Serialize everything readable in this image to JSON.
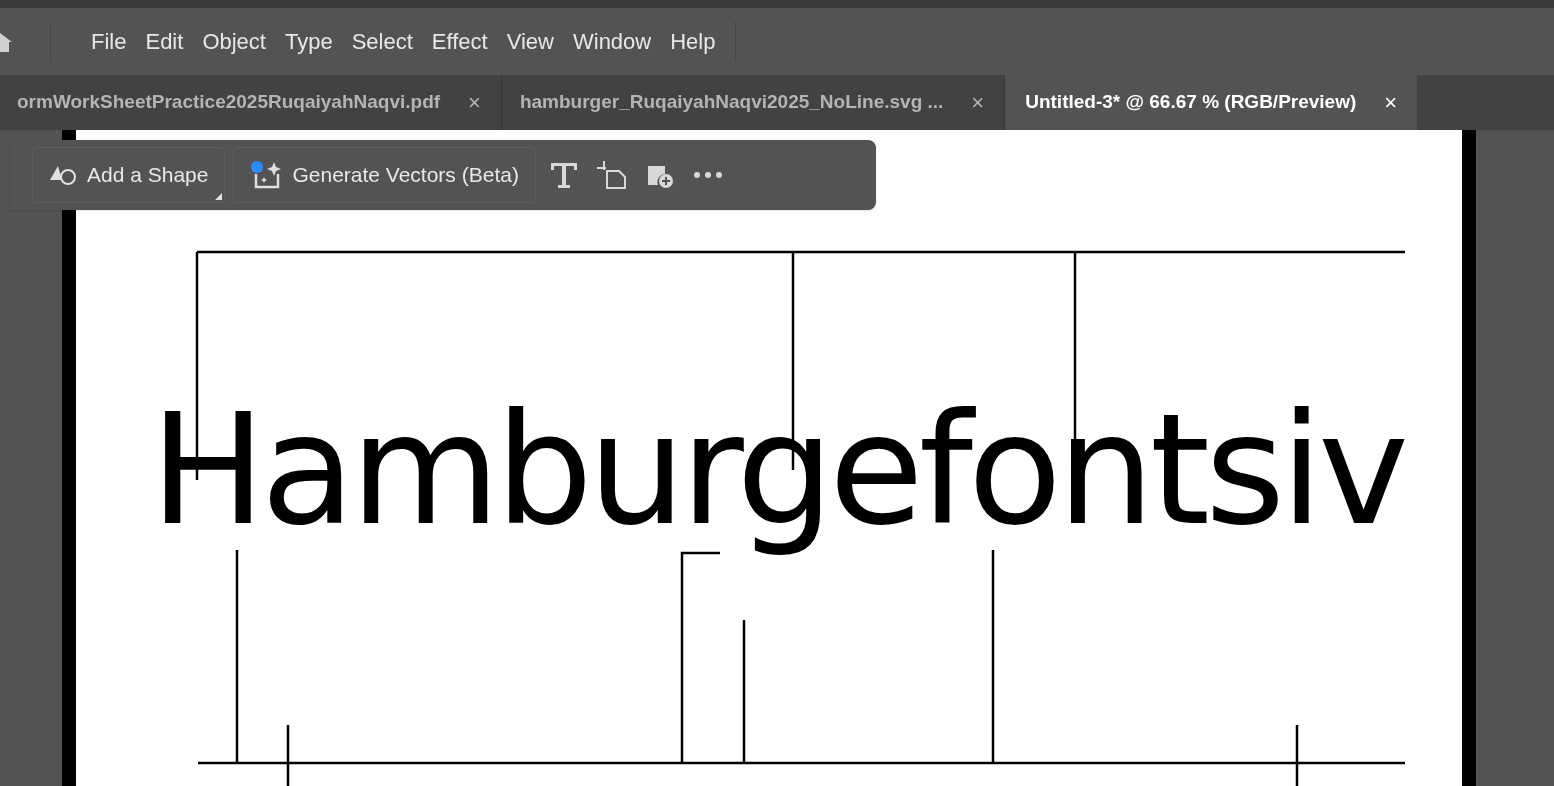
{
  "menu": {
    "items": [
      "File",
      "Edit",
      "Object",
      "Type",
      "Select",
      "Effect",
      "View",
      "Window",
      "Help"
    ]
  },
  "tabs": [
    {
      "label": "ormWorkSheetPractice2025RuqaiyahNaqvi.pdf",
      "close": "×",
      "selected": false
    },
    {
      "label": "hamburger_RuqaiyahNaqvi2025_NoLine.svg ...",
      "close": "×",
      "selected": false
    },
    {
      "label": "Untitled-3* @ 66.67 % (RGB/Preview)",
      "close": "×",
      "selected": true
    }
  ],
  "toolbar": {
    "items": [
      {
        "kind": "shape",
        "label": "Add a Shape"
      },
      {
        "kind": "generate",
        "label": "Generate Vectors (Beta)"
      },
      {
        "kind": "type"
      },
      {
        "kind": "artboard"
      },
      {
        "kind": "image"
      },
      {
        "kind": "more"
      }
    ]
  },
  "artboard": {
    "text": "Hamburgefontsiv"
  }
}
